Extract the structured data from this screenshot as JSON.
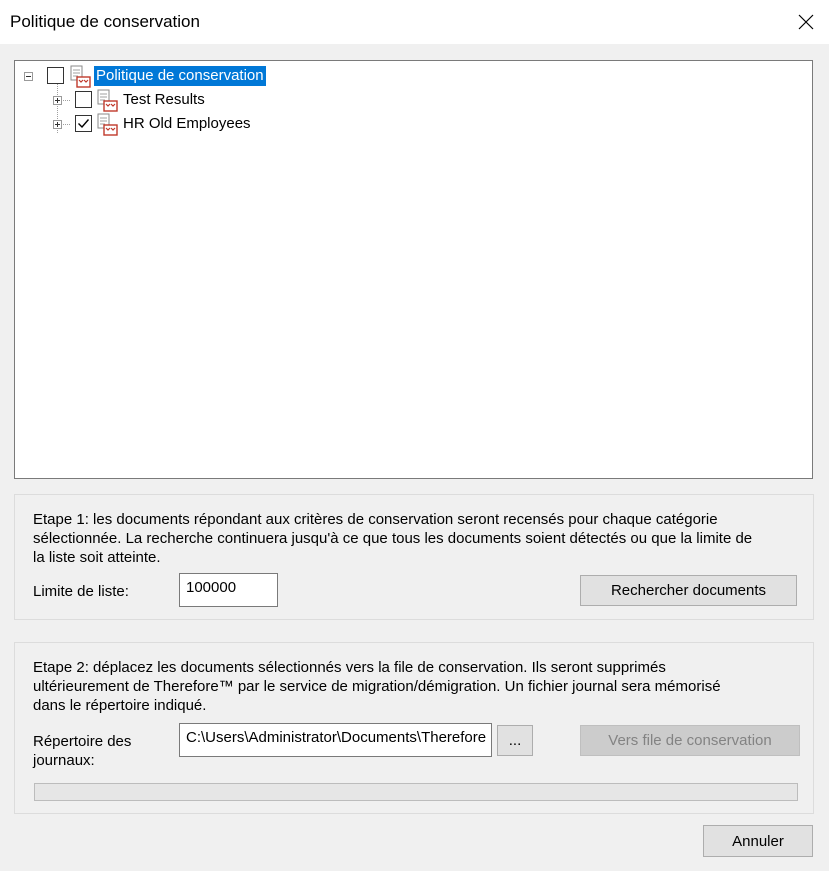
{
  "window": {
    "title": "Politique de conservation"
  },
  "tree": {
    "root": {
      "label": "Politique de conservation",
      "checked": false,
      "expanded": true,
      "selected": true
    },
    "children": [
      {
        "label": "Test Results",
        "checked": false,
        "expanded": false
      },
      {
        "label": "HR Old Employees",
        "checked": true,
        "expanded": false
      }
    ]
  },
  "step1": {
    "description_lines": [
      "Etape 1: les documents répondant aux critères de conservation seront recensés pour chaque catégorie",
      "sélectionnée. La recherche continuera jusqu'à ce que tous les documents soient détectés ou que la limite de",
      "la liste soit atteinte."
    ],
    "limit_label": "Limite de liste:",
    "limit_value": "100000",
    "search_button": "Rechercher documents"
  },
  "step2": {
    "description_lines": [
      "Etape 2: déplacez les documents sélectionnés vers la file de conservation. Ils seront supprimés",
      "ultérieurement de Therefore™ par le service de migration/démigration. Un fichier journal sera mémorisé",
      "dans le répertoire indiqué."
    ],
    "log_dir_label_lines": [
      "Répertoire des",
      "journaux:"
    ],
    "log_dir_value": "C:\\Users\\Administrator\\Documents\\Therefore",
    "browse_button": "...",
    "queue_button": "Vers file de conservation",
    "progress": 0
  },
  "footer": {
    "cancel_button": "Annuler"
  }
}
